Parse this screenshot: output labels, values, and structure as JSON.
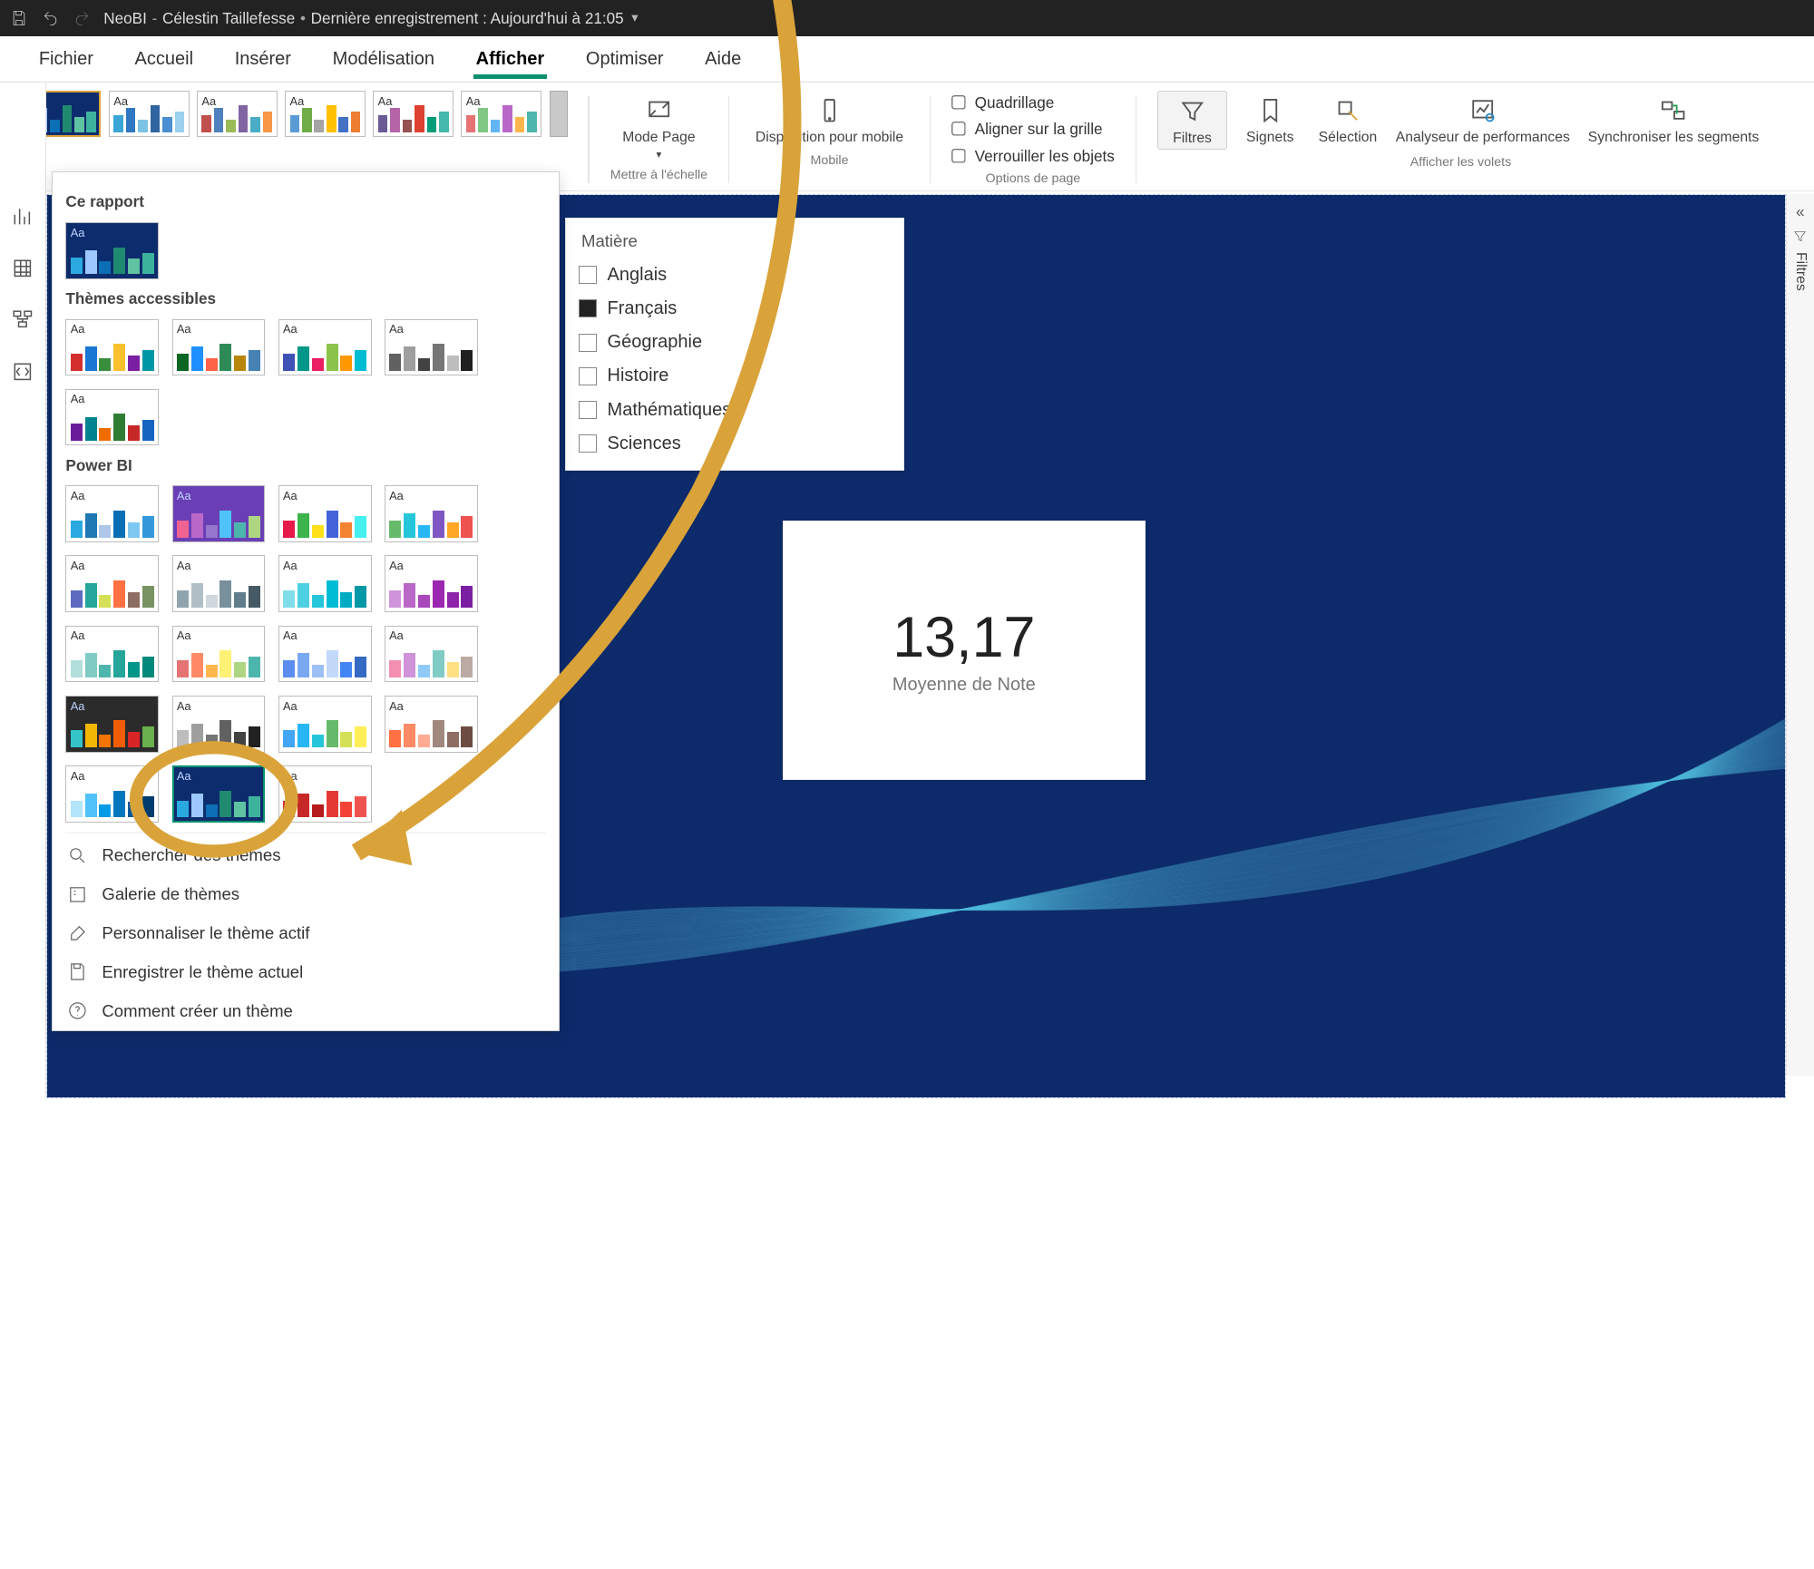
{
  "titlebar": {
    "doc_name": "NeoBI",
    "author": "Célestin Taillefesse",
    "saved": "Dernière enregistrement : Aujourd'hui à 21:05"
  },
  "menu": {
    "tabs": [
      "Fichier",
      "Accueil",
      "Insérer",
      "Modélisation",
      "Afficher",
      "Optimiser",
      "Aide"
    ],
    "active_index": 4
  },
  "ribbon": {
    "group_scale": {
      "label": "Mettre à l'échelle",
      "btn1": "Mode Page"
    },
    "group_mobile": {
      "label": "Mobile",
      "btn1": "Disposition pour mobile"
    },
    "group_pageopts": {
      "label": "Options de page",
      "chk1": "Quadrillage",
      "chk2": "Aligner sur la grille",
      "chk3": "Verrouiller les objets"
    },
    "group_panes": {
      "label": "Afficher les volets",
      "b1": "Filtres",
      "b2": "Signets",
      "b3": "Sélection",
      "b4": "Analyseur de performances",
      "b5": "Synchroniser les segments"
    }
  },
  "theme_panel": {
    "section_report": "Ce rapport",
    "section_accessible": "Thèmes accessibles",
    "section_pbi": "Power BI",
    "act_search": "Rechercher des thèmes",
    "act_gallery": "Galerie de thèmes",
    "act_customize": "Personnaliser le thème actif",
    "act_save": "Enregistrer le thème actuel",
    "act_help": "Comment créer un thème"
  },
  "right_pane": {
    "label": "Filtres"
  },
  "slicer": {
    "title": "Matière",
    "items": [
      {
        "label": "Anglais",
        "checked": false
      },
      {
        "label": "Français",
        "checked": true
      },
      {
        "label": "Géographie",
        "checked": false
      },
      {
        "label": "Histoire",
        "checked": false
      },
      {
        "label": "Mathématiques",
        "checked": false
      },
      {
        "label": "Sciences",
        "checked": false
      }
    ]
  },
  "card": {
    "value": "13,17",
    "label": "Moyenne de Note"
  },
  "chart_data": {
    "type": "table",
    "title": "Moyenne de Note",
    "series": [
      {
        "name": "Moyenne de Note",
        "values": [
          13.17
        ]
      }
    ],
    "note": "single KPI card value; slicer field = Matière; selected = Français"
  },
  "theme_thumbs": {
    "strip": [
      {
        "dark": true,
        "selected": true,
        "colors": [
          "#2aa9e0",
          "#9cc7ff",
          "#0b6fb5",
          "#1f8a70",
          "#5fc2a0",
          "#3db39e"
        ]
      },
      {
        "dark": false,
        "selected": false,
        "colors": [
          "#3aa6d8",
          "#2f77c0",
          "#7cc3e6",
          "#2f64a0",
          "#4a8fd1",
          "#9bd0ee"
        ]
      },
      {
        "dark": false,
        "selected": false,
        "colors": [
          "#c0504d",
          "#4f81bd",
          "#9bbb59",
          "#8064a2",
          "#4bacc6",
          "#f79646"
        ]
      },
      {
        "dark": false,
        "selected": false,
        "colors": [
          "#5b9bd5",
          "#70ad47",
          "#a5a5a5",
          "#ffc000",
          "#4472c4",
          "#ed7d31"
        ]
      },
      {
        "dark": false,
        "selected": false,
        "colors": [
          "#6b5b95",
          "#b565a7",
          "#955251",
          "#dd4132",
          "#009b77",
          "#45b8ac"
        ]
      },
      {
        "dark": false,
        "selected": false,
        "colors": [
          "#e57373",
          "#81c784",
          "#64b5f6",
          "#ba68c8",
          "#ffb74d",
          "#4db6ac"
        ]
      }
    ],
    "accessible": [
      {
        "colors": [
          "#d32f2f",
          "#1976d2",
          "#388e3c",
          "#fbc02d",
          "#7b1fa2",
          "#0097a7"
        ]
      },
      {
        "colors": [
          "#0b6623",
          "#1e90ff",
          "#ff6347",
          "#2e8b57",
          "#b8860b",
          "#4682b4"
        ]
      },
      {
        "colors": [
          "#3f51b5",
          "#009688",
          "#e91e63",
          "#8bc34a",
          "#ff9800",
          "#00bcd4"
        ]
      },
      {
        "colors": [
          "#616161",
          "#9e9e9e",
          "#424242",
          "#757575",
          "#bdbdbd",
          "#212121"
        ]
      },
      {
        "colors": [
          "#6a1b9a",
          "#00838f",
          "#ef6c00",
          "#2e7d32",
          "#c62828",
          "#1565c0"
        ]
      }
    ],
    "pbi": [
      {
        "colors": [
          "#2aa9e0",
          "#1f77b4",
          "#aec7e8",
          "#0b6fb5",
          "#7dc8f0",
          "#3498db"
        ]
      },
      {
        "dark": true,
        "bg": "#6a3fb5",
        "colors": [
          "#f06292",
          "#ba68c8",
          "#9575cd",
          "#4fc3f7",
          "#4db6ac",
          "#aed581"
        ]
      },
      {
        "colors": [
          "#e6194b",
          "#3cb44b",
          "#ffe119",
          "#4363d8",
          "#f58231",
          "#46f0f0"
        ]
      },
      {
        "colors": [
          "#66bb6a",
          "#26c6da",
          "#29b6f6",
          "#7e57c2",
          "#ffa726",
          "#ef5350"
        ]
      },
      {
        "colors": [
          "#5c6bc0",
          "#26a69a",
          "#d4e157",
          "#ff7043",
          "#8d6e63",
          "#789262"
        ]
      },
      {
        "colors": [
          "#90a4ae",
          "#b0bec5",
          "#cfd8dc",
          "#78909c",
          "#607d8b",
          "#455a64"
        ]
      },
      {
        "colors": [
          "#80deea",
          "#4dd0e1",
          "#26c6da",
          "#00bcd4",
          "#00acc1",
          "#0097a7"
        ]
      },
      {
        "colors": [
          "#ce93d8",
          "#ba68c8",
          "#ab47bc",
          "#9c27b0",
          "#8e24aa",
          "#7b1fa2"
        ]
      },
      {
        "colors": [
          "#b2dfdb",
          "#80cbc4",
          "#4db6ac",
          "#26a69a",
          "#009688",
          "#00897b"
        ]
      },
      {
        "colors": [
          "#e57373",
          "#ff8a65",
          "#ffb74d",
          "#fff176",
          "#aed581",
          "#4db6ac"
        ]
      },
      {
        "colors": [
          "#5b8def",
          "#7aa7f2",
          "#9cc0f6",
          "#c2d9fa",
          "#4285f4",
          "#356ac3"
        ]
      },
      {
        "colors": [
          "#f48fb1",
          "#ce93d8",
          "#90caf9",
          "#80cbc4",
          "#ffe082",
          "#bcaaa4"
        ]
      },
      {
        "dark": true,
        "bg": "#2b2b2b",
        "colors": [
          "#35c4c8",
          "#f2b705",
          "#f27405",
          "#f25c05",
          "#d92525",
          "#6ab04c"
        ]
      },
      {
        "colors": [
          "#bdbdbd",
          "#9e9e9e",
          "#757575",
          "#616161",
          "#424242",
          "#212121"
        ]
      },
      {
        "colors": [
          "#42a5f5",
          "#29b6f6",
          "#26c6da",
          "#66bb6a",
          "#d4e157",
          "#ffee58"
        ]
      },
      {
        "colors": [
          "#ff7043",
          "#ff8a65",
          "#ffab91",
          "#a1887f",
          "#8d6e63",
          "#6d4c41"
        ]
      },
      {
        "colors": [
          "#b3e5fc",
          "#4fc3f7",
          "#039be5",
          "#0277bd",
          "#01579b",
          "#003c6c"
        ]
      },
      {
        "dark": true,
        "bg": "#0d2c6d",
        "colors": [
          "#2aa9e0",
          "#9cc7ff",
          "#0b6fb5",
          "#1f8a70",
          "#5fc2a0",
          "#3db39e"
        ],
        "highlight": true
      },
      {
        "colors": [
          "#d32f2f",
          "#c62828",
          "#b71c1c",
          "#e53935",
          "#f44336",
          "#ef5350"
        ]
      }
    ]
  }
}
